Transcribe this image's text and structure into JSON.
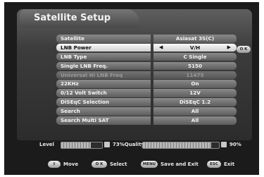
{
  "title": "Satellite Setup",
  "ok_label": "O K",
  "rows": [
    {
      "label": "Satellite",
      "value": "Asiasat 3S(C)",
      "state": "normal"
    },
    {
      "label": "LNB Power",
      "value": "V/H",
      "state": "selected"
    },
    {
      "label": "LNB Type",
      "value": "C Single",
      "state": "normal"
    },
    {
      "label": "Single LNB Freq.",
      "value": "5150",
      "state": "normal"
    },
    {
      "label": "Universal Hi LNB Freq",
      "value": "11475",
      "state": "disabled"
    },
    {
      "label": "22KHz",
      "value": "On",
      "state": "normal"
    },
    {
      "label": "0/12 Volt Switch",
      "value": "12V",
      "state": "normal"
    },
    {
      "label": "DiSEqC Selection",
      "value": "DiSEqC 1.2",
      "state": "normal"
    },
    {
      "label": "Search",
      "value": "All",
      "state": "normal"
    },
    {
      "label": "Search Multi SAT",
      "value": "All",
      "state": "normal"
    }
  ],
  "status": {
    "level_label": "Level",
    "quality_text": "73%Quality",
    "level_percent": 73,
    "quality_percent": 90,
    "quality_value": "90%"
  },
  "help": {
    "move_label": "Move",
    "ok_key": "O K",
    "select_label": "Select",
    "menu_key": "MENU",
    "save_label": "Save and Exit",
    "esc_key": "ESC",
    "exit_label": "Exit"
  }
}
